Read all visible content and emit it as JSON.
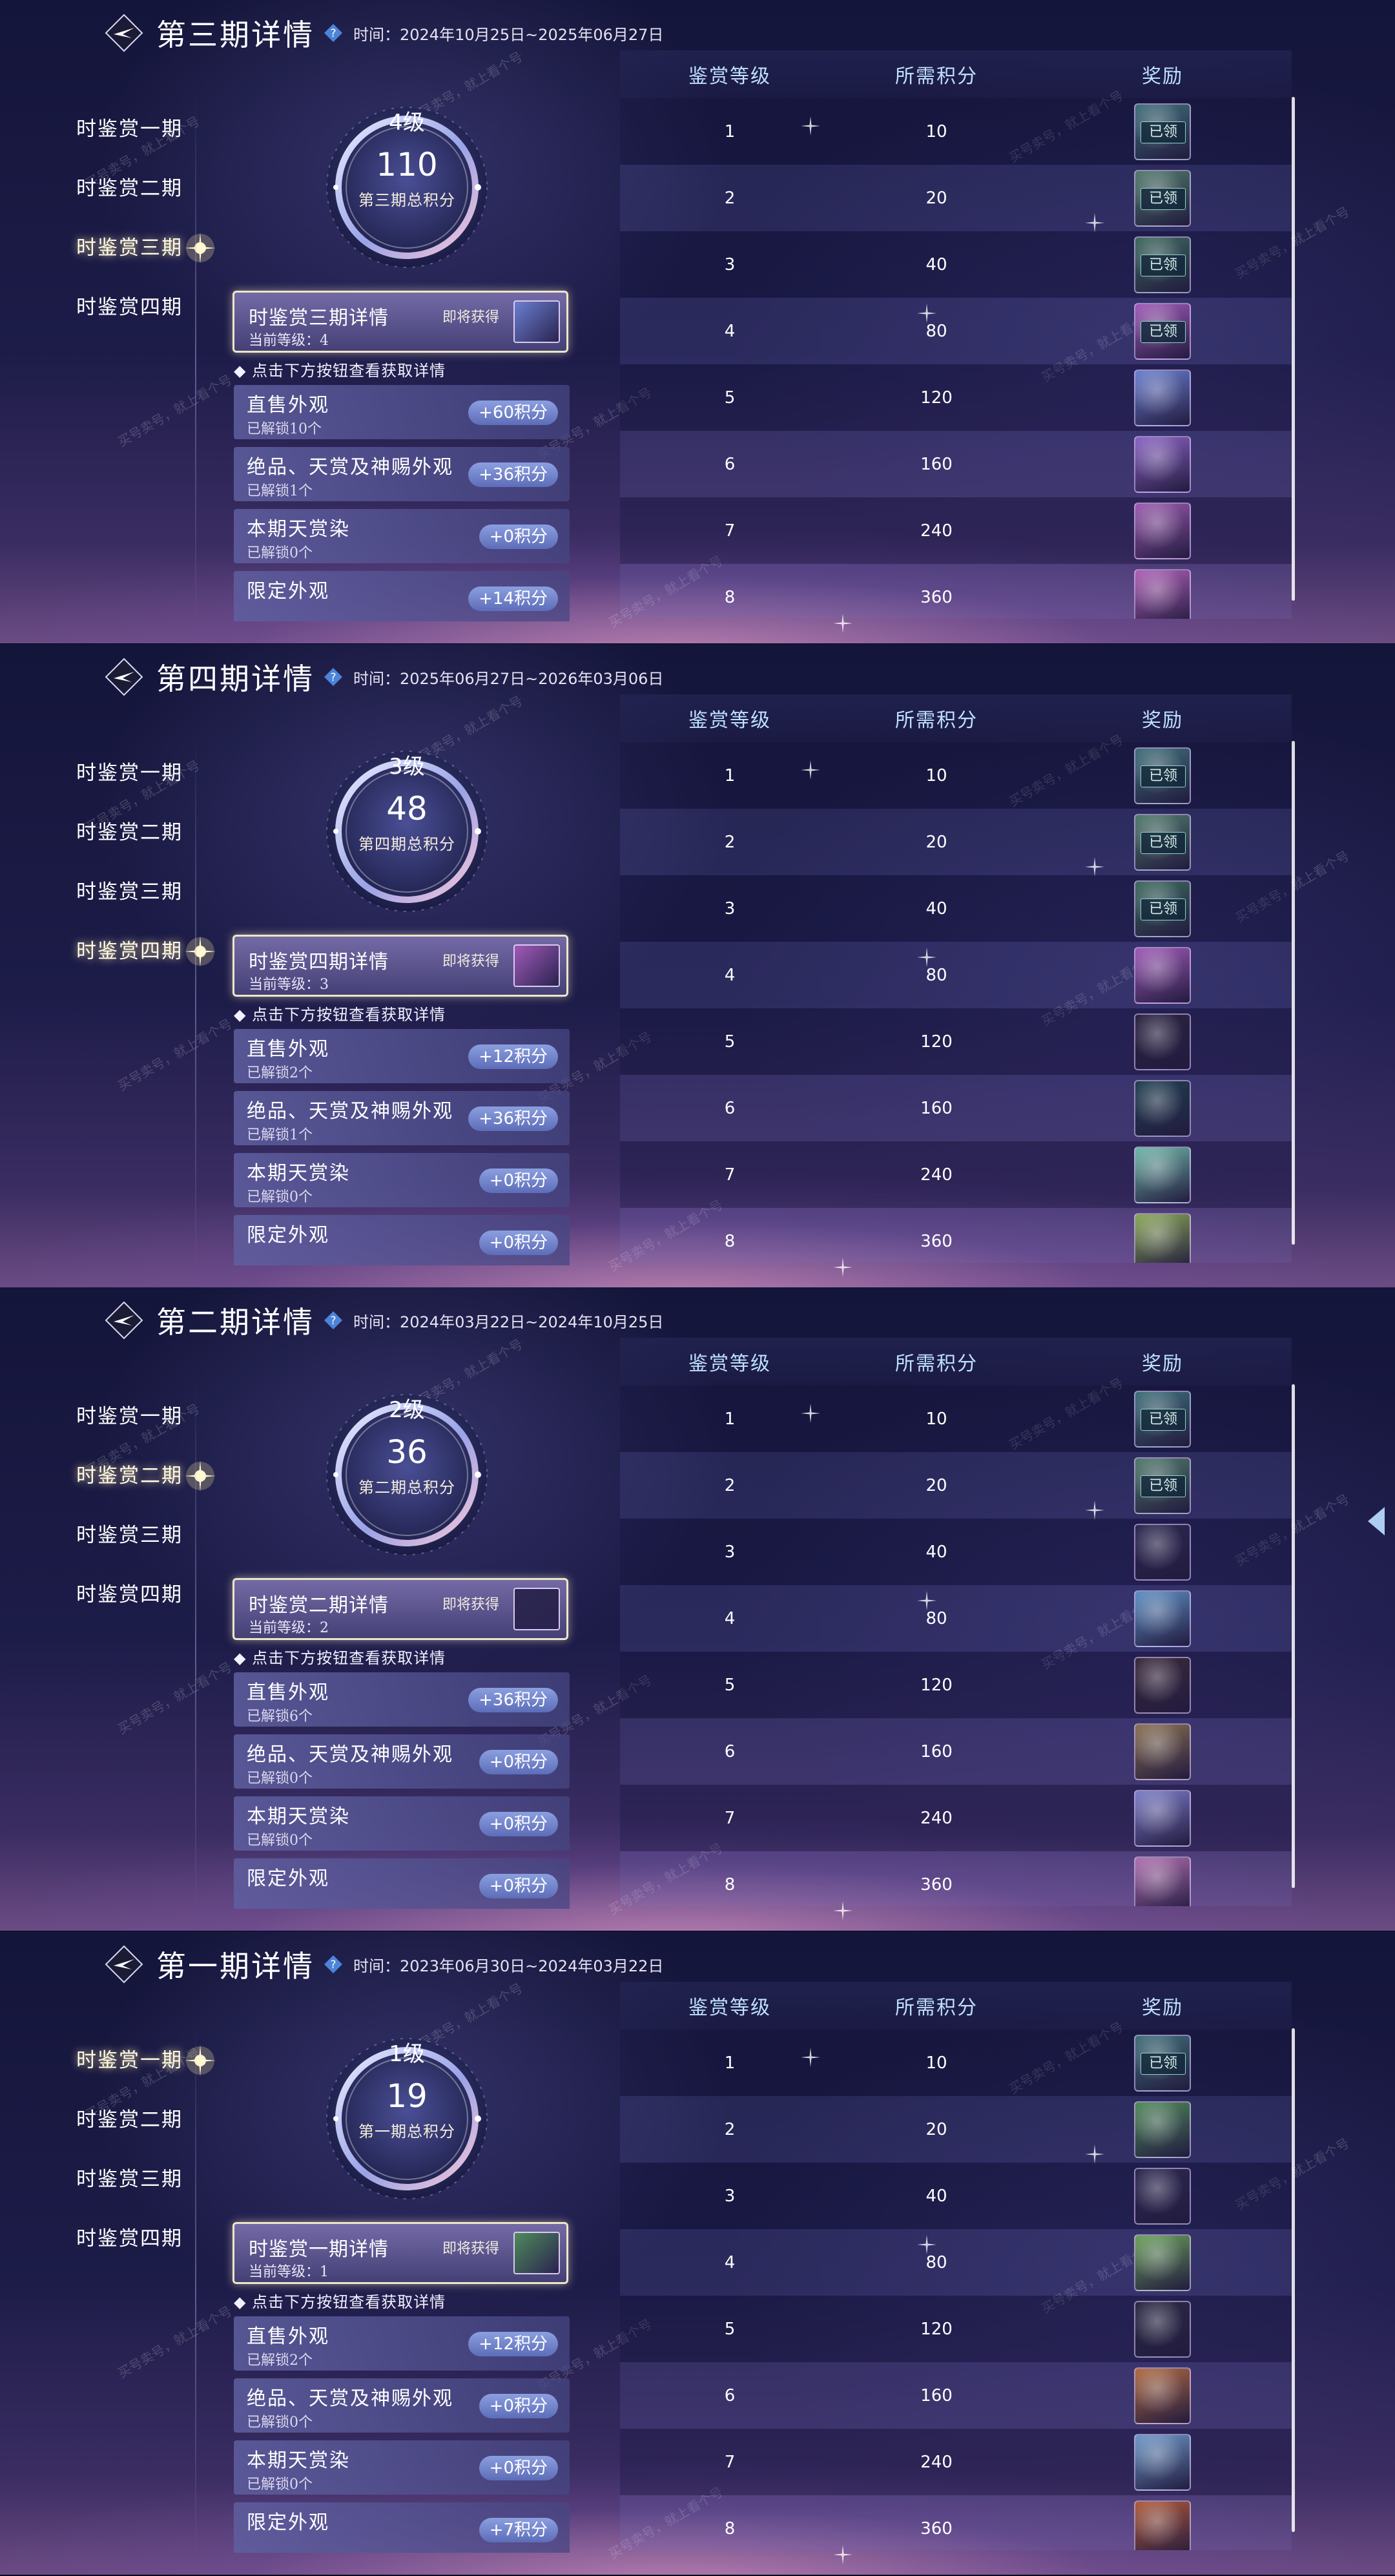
{
  "nav_labels": [
    "时鉴赏一期",
    "时鉴赏二期",
    "时鉴赏三期",
    "时鉴赏四期"
  ],
  "table_headers": {
    "level": "鉴赏等级",
    "points": "所需积分",
    "reward": "奖励"
  },
  "claimed_label": "已领",
  "upcoming_label": "即将获得",
  "hint_text": "◆ 点击下方按钮查看获取详情",
  "watermark": "买号卖号，就上看个号",
  "panels": [
    {
      "title": "第三期详情",
      "time": "时间：2024年10月25日~2025年06月27日",
      "active_nav": 2,
      "medal": {
        "level": "4级",
        "score": "110",
        "caption": "第三期总积分"
      },
      "detail": {
        "title": "时鉴赏三期详情",
        "current_level": "当前等级：4"
      },
      "categories": [
        {
          "name": "直售外观",
          "sub": "已解锁10个",
          "points": "+60积分"
        },
        {
          "name": "绝品、天赏及神赐外观",
          "sub": "已解锁1个",
          "points": "+36积分"
        },
        {
          "name": "本期天赏染",
          "sub": "已解锁0个",
          "points": "+0积分"
        },
        {
          "name": "限定外观",
          "sub": "",
          "points": "+14积分"
        }
      ],
      "rows": [
        {
          "level": "1",
          "points": "10",
          "claimed": true,
          "color": "#3f6f7a"
        },
        {
          "level": "2",
          "points": "20",
          "claimed": true,
          "color": "#4f7a6a"
        },
        {
          "level": "3",
          "points": "40",
          "claimed": true,
          "color": "#3c6a5e"
        },
        {
          "level": "4",
          "points": "80",
          "claimed": true,
          "color": "#a05ab8"
        },
        {
          "level": "5",
          "points": "120",
          "claimed": false,
          "color": "#6a7fd0"
        },
        {
          "level": "6",
          "points": "160",
          "claimed": false,
          "color": "#8b63c4"
        },
        {
          "level": "7",
          "points": "240",
          "claimed": false,
          "color": "#9c5ab0"
        },
        {
          "level": "8",
          "points": "360",
          "claimed": false,
          "color": "#b060b8"
        }
      ]
    },
    {
      "title": "第四期详情",
      "time": "时间：2025年06月27日~2026年03月06日",
      "active_nav": 3,
      "medal": {
        "level": "3级",
        "score": "48",
        "caption": "第四期总积分"
      },
      "detail": {
        "title": "时鉴赏四期详情",
        "current_level": "当前等级：3"
      },
      "categories": [
        {
          "name": "直售外观",
          "sub": "已解锁2个",
          "points": "+12积分"
        },
        {
          "name": "绝品、天赏及神赐外观",
          "sub": "已解锁1个",
          "points": "+36积分"
        },
        {
          "name": "本期天赏染",
          "sub": "已解锁0个",
          "points": "+0积分"
        },
        {
          "name": "限定外观",
          "sub": "",
          "points": "+0积分"
        }
      ],
      "rows": [
        {
          "level": "1",
          "points": "10",
          "claimed": true,
          "color": "#3f6f7a"
        },
        {
          "level": "2",
          "points": "20",
          "claimed": true,
          "color": "#4f7a6a"
        },
        {
          "level": "3",
          "points": "40",
          "claimed": true,
          "color": "#3c6a5e"
        },
        {
          "level": "4",
          "points": "80",
          "claimed": false,
          "color": "#a05ab8"
        },
        {
          "level": "5",
          "points": "120",
          "claimed": false,
          "color": "#2a2440"
        },
        {
          "level": "6",
          "points": "160",
          "claimed": false,
          "color": "#1f3f4f"
        },
        {
          "level": "7",
          "points": "240",
          "claimed": false,
          "color": "#6fb7a8"
        },
        {
          "level": "8",
          "points": "360",
          "claimed": false,
          "color": "#8aa856"
        }
      ]
    },
    {
      "title": "第二期详情",
      "time": "时间：2024年03月22日~2024年10月25日",
      "active_nav": 1,
      "medal": {
        "level": "2级",
        "score": "36",
        "caption": "第二期总积分"
      },
      "detail": {
        "title": "时鉴赏二期详情",
        "current_level": "当前等级：2"
      },
      "categories": [
        {
          "name": "直售外观",
          "sub": "已解锁6个",
          "points": "+36积分"
        },
        {
          "name": "绝品、天赏及神赐外观",
          "sub": "已解锁0个",
          "points": "+0积分"
        },
        {
          "name": "本期天赏染",
          "sub": "已解锁0个",
          "points": "+0积分"
        },
        {
          "name": "限定外观",
          "sub": "",
          "points": "+0积分"
        }
      ],
      "rows": [
        {
          "level": "1",
          "points": "10",
          "claimed": true,
          "color": "#3f6f7a"
        },
        {
          "level": "2",
          "points": "20",
          "claimed": true,
          "color": "#4f7a6a"
        },
        {
          "level": "3",
          "points": "40",
          "claimed": false,
          "color": "#2c2850"
        },
        {
          "level": "4",
          "points": "80",
          "claimed": false,
          "color": "#5d8fc4"
        },
        {
          "level": "5",
          "points": "120",
          "claimed": false,
          "color": "#3a2a3a"
        },
        {
          "level": "6",
          "points": "160",
          "claimed": false,
          "color": "#8a7050"
        },
        {
          "level": "7",
          "points": "240",
          "claimed": false,
          "color": "#7c7cc8"
        },
        {
          "level": "8",
          "points": "360",
          "claimed": false,
          "color": "#b070b0"
        }
      ]
    },
    {
      "title": "第一期详情",
      "time": "时间：2023年06月30日~2024年03月22日",
      "active_nav": 0,
      "medal": {
        "level": "1级",
        "score": "19",
        "caption": "第一期总积分"
      },
      "detail": {
        "title": "时鉴赏一期详情",
        "current_level": "当前等级：1"
      },
      "categories": [
        {
          "name": "直售外观",
          "sub": "已解锁2个",
          "points": "+12积分"
        },
        {
          "name": "绝品、天赏及神赐外观",
          "sub": "已解锁0个",
          "points": "+0积分"
        },
        {
          "name": "本期天赏染",
          "sub": "已解锁0个",
          "points": "+0积分"
        },
        {
          "name": "限定外观",
          "sub": "",
          "points": "+7积分"
        }
      ],
      "rows": [
        {
          "level": "1",
          "points": "10",
          "claimed": true,
          "color": "#3f6f7a"
        },
        {
          "level": "2",
          "points": "20",
          "claimed": false,
          "color": "#4f8a5a"
        },
        {
          "level": "3",
          "points": "40",
          "claimed": false,
          "color": "#2c2850"
        },
        {
          "level": "4",
          "points": "80",
          "claimed": false,
          "color": "#6aa05a"
        },
        {
          "level": "5",
          "points": "120",
          "claimed": false,
          "color": "#2a2a44"
        },
        {
          "level": "6",
          "points": "160",
          "claimed": false,
          "color": "#b06a40"
        },
        {
          "level": "7",
          "points": "240",
          "claimed": false,
          "color": "#6c98c8"
        },
        {
          "level": "8",
          "points": "360",
          "claimed": false,
          "color": "#b05a3a"
        }
      ]
    }
  ]
}
